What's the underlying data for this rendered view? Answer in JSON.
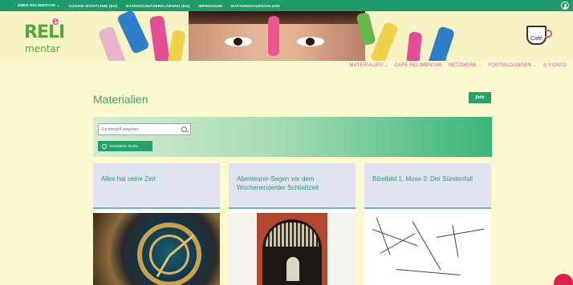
{
  "topbar": {
    "links": [
      {
        "label": "ÜBER RELIMENTAR",
        "chevron": "⌄"
      },
      {
        "label": "COOKIE-RICHTLINIE (EU)"
      },
      {
        "label": "DATENSCHUTZERKLÄRUNG (EU)"
      },
      {
        "label": "IMPRESSUM"
      },
      {
        "label": "HAFTUNGSAUSSCHLUSS"
      }
    ],
    "user_icon": "user-circle-icon"
  },
  "banner": {
    "logo_text": "RELI",
    "logo_superscript": "e",
    "logo_subtext": "mentar",
    "cafe_label": "Café"
  },
  "mainnav": {
    "items": [
      {
        "label": "MATERIALIEN",
        "chevron": "⌄"
      },
      {
        "label": "CAFÉ RELIMENTAR"
      },
      {
        "label": "NETZWERK",
        "chevron": "⌄"
      },
      {
        "label": "FORTBILDUNGEN",
        "chevron": "⌄"
      },
      {
        "label": "KONTO",
        "icon": "user-icon"
      }
    ]
  },
  "page": {
    "title": "Materialien",
    "info_button": "Info"
  },
  "search": {
    "placeholder": "Suchbegriff eingeben",
    "extended_label": "Erweiterte Suche"
  },
  "cards": [
    {
      "title": "Alles hat seine Zeit"
    },
    {
      "title": "Abenteurer-Segen vor dem Wochenende/der Schließzeit"
    },
    {
      "title": "Bibelbild 1. Mose 3: Der Sündenfall"
    }
  ],
  "colors": {
    "topbar": "#1f9a6a",
    "background": "#fdf9cf",
    "accent_green": "#27a06a",
    "nav_pink": "#d8559a"
  }
}
